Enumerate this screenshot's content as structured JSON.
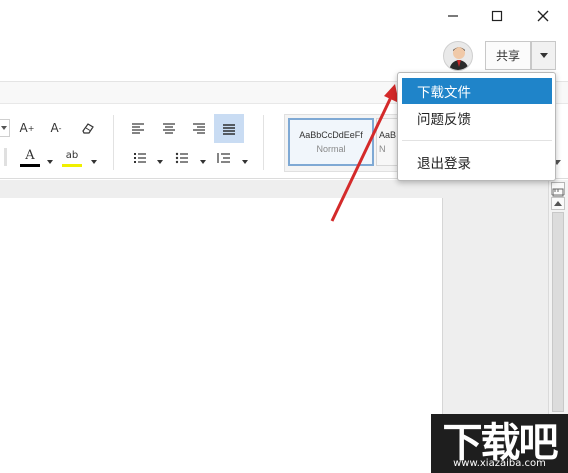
{
  "window": {
    "minimize_icon": "minimize-icon",
    "maximize_icon": "maximize-icon",
    "close_icon": "close-icon"
  },
  "header": {
    "share_label": "共享",
    "avatar_icon": "user-avatar"
  },
  "toolbar": {
    "font_grow": "A",
    "font_shrink": "A",
    "font_color_label": "A",
    "highlight_label": "ab"
  },
  "styles": [
    {
      "preview": "AaBbCcDdEeFf",
      "name": "Normal"
    },
    {
      "preview": "AaB",
      "name": "N"
    }
  ],
  "menu": {
    "items": [
      {
        "label": "下载文件"
      },
      {
        "label": "问题反馈"
      },
      {
        "label": "退出登录"
      }
    ]
  },
  "watermark": {
    "title": "下载吧",
    "url": "www.xiazaiba.com"
  },
  "colors": {
    "menu_highlight": "#1f84c9",
    "font_color_bar": "#000000",
    "highlight_bar": "#f0f000",
    "arrow": "#d42a2a",
    "align_active": "#c9dcf3"
  }
}
